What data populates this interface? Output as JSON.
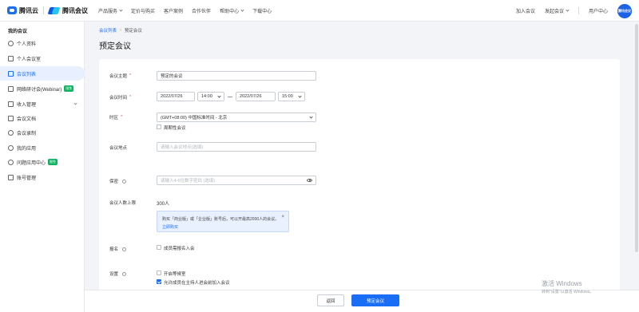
{
  "header": {
    "brand1": "腾讯云",
    "brand2": "腾讯会议",
    "nav": [
      {
        "label": "产品服务"
      },
      {
        "label": "定价与购买"
      },
      {
        "label": "客户案例"
      },
      {
        "label": "合作伙伴"
      },
      {
        "label": "帮助中心"
      },
      {
        "label": "下载中心"
      }
    ],
    "join_meeting": "加入会议",
    "start_meeting": "发起会议",
    "user_center": "用户中心",
    "avatar_text": "腾讯会议"
  },
  "sidebar": {
    "title": "我的会议",
    "items": [
      {
        "label": "个人资料"
      },
      {
        "label": "个人会议室"
      },
      {
        "label": "会议列表"
      },
      {
        "label": "网络研讨会(Webinar)",
        "badge": "限免"
      },
      {
        "label": "收入管理"
      },
      {
        "label": "会议文档"
      },
      {
        "label": "会议录制"
      },
      {
        "label": "我的应用"
      },
      {
        "label": "问题应用中心",
        "badge": "限免"
      },
      {
        "label": "账号管理"
      }
    ]
  },
  "breadcrumb": {
    "parent": "会议列表",
    "separator": "›",
    "current": "预定会议"
  },
  "page_title": "预定会议",
  "form": {
    "subject": {
      "label": "会议主题",
      "value": "预定的会议"
    },
    "time": {
      "label": "会议时间",
      "start_date": "2022/07/26",
      "start_time": "14:00",
      "end_date": "2022/07/26",
      "end_time": "15:00"
    },
    "timezone": {
      "label": "时区",
      "value": "(GMT+08:00) 中国标准时间 - 北京",
      "periodic_label": "周期性会议"
    },
    "location": {
      "label": "会议地点",
      "placeholder": "请输入会议地点(选填)"
    },
    "password": {
      "label": "保密",
      "placeholder": "请输入4-6位数字密码 (选填)"
    },
    "capacity": {
      "label": "会议人数上限",
      "value": "300人",
      "notice": "购买「商业版」或「企业版」账号后，可以开最高2000人的会议。",
      "notice_link": "立即购买",
      "notice_close": "×"
    },
    "registration": {
      "label": "报名",
      "option": "成员需报名入会"
    },
    "settings": {
      "label": "设置",
      "options": [
        {
          "label": "开启等候室",
          "checked": false
        },
        {
          "label": "允许成员在主持人进会前加入会议",
          "checked": true
        }
      ]
    }
  },
  "footer": {
    "back": "返回",
    "submit": "预定会议"
  },
  "watermark": {
    "line1": "激活 Windows",
    "line2": "转到\"设置\"以激活 Windows。"
  },
  "colors": {
    "primary": "#1a6ef5",
    "badge": "#0cb35f",
    "required": "#e34d4d"
  }
}
